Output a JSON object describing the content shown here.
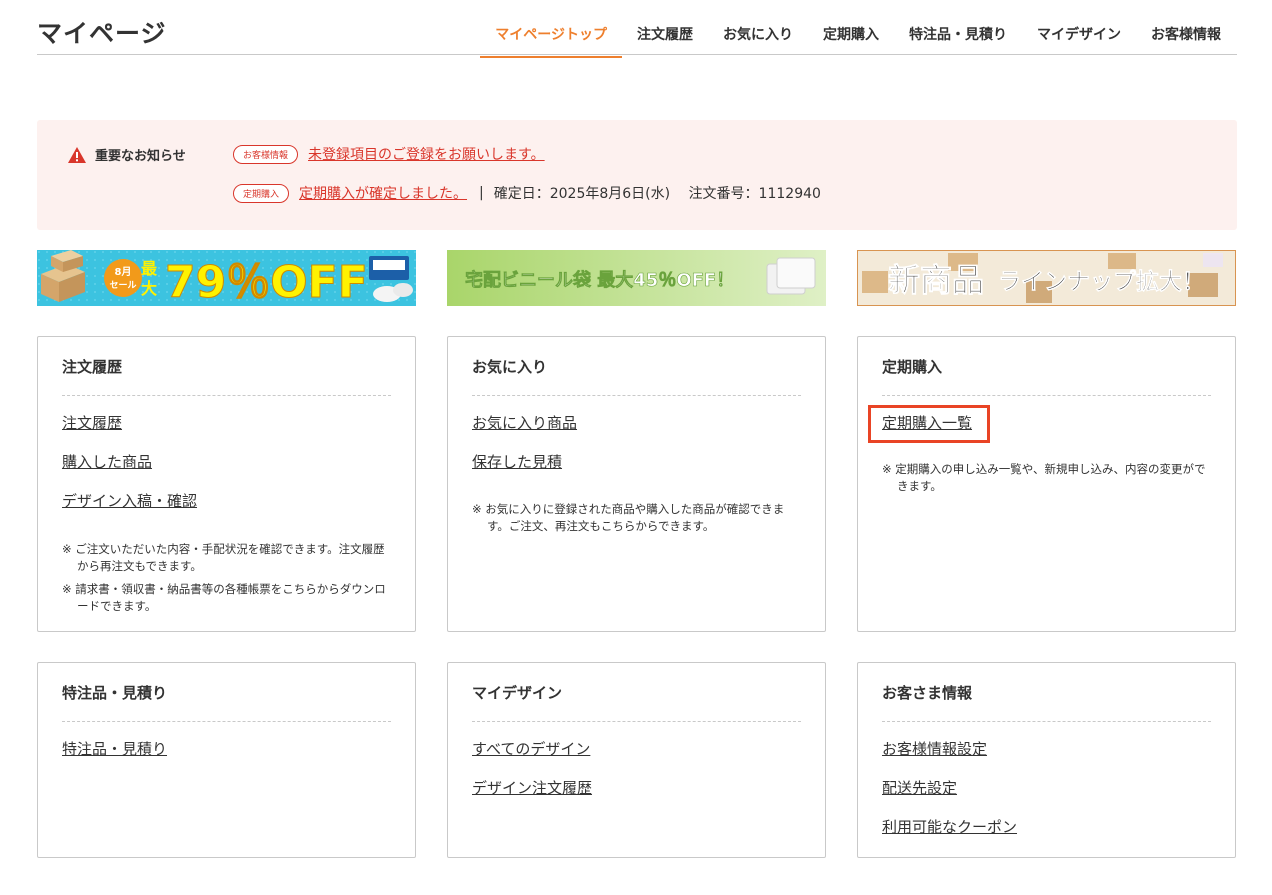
{
  "header": {
    "title": "マイページ",
    "nav": [
      {
        "label": "マイページトップ",
        "active": true
      },
      {
        "label": "注文履歴"
      },
      {
        "label": "お気に入り"
      },
      {
        "label": "定期購入"
      },
      {
        "label": "特注品・見積り"
      },
      {
        "label": "マイデザイン"
      },
      {
        "label": "お客様情報"
      }
    ]
  },
  "notice": {
    "heading": "重要なお知らせ",
    "items": [
      {
        "tag": "お客様情報",
        "link": "未登録項目のご登録をお願いします。"
      },
      {
        "tag": "定期購入",
        "link": "定期購入が確定しました。",
        "date": "確定日：2025年8月6日(水)",
        "order": "注文番号：1112940"
      }
    ]
  },
  "banners": {
    "b1": {
      "badge": "8月\nセール",
      "prefix": "最大",
      "main": "79％OFF"
    },
    "b2": {
      "text": "宅配ビニール袋 最大45％OFF！"
    },
    "b3": {
      "main": "新商品",
      "sub": "ラインナップ拡大！"
    }
  },
  "cards": {
    "orders": {
      "title": "注文履歴",
      "links": [
        "注文履歴",
        "購入した商品",
        "デザイン入稿・確認"
      ],
      "notes": [
        "※ ご注文いただいた内容・手配状況を確認できます。注文履歴から再注文もできます。",
        "※ 請求書・領収書・納品書等の各種帳票をこちらからダウンロードできます。"
      ]
    },
    "favorites": {
      "title": "お気に入り",
      "links": [
        "お気に入り商品",
        "保存した見積"
      ],
      "notes": [
        "※ お気に入りに登録された商品や購入した商品が確認できます。ご注文、再注文もこちらからできます。"
      ]
    },
    "subscription": {
      "title": "定期購入",
      "links": [
        "定期購入一覧"
      ],
      "notes": [
        "※ 定期購入の申し込み一覧や、新規申し込み、内容の変更ができます。"
      ]
    },
    "custom": {
      "title": "特注品・見積り",
      "links": [
        "特注品・見積り"
      ]
    },
    "mydesign": {
      "title": "マイデザイン",
      "links": [
        "すべてのデザイン",
        "デザイン注文履歴"
      ]
    },
    "customer": {
      "title": "お客さま情報",
      "links": [
        "お客様情報設定",
        "配送先設定",
        "利用可能なクーポン"
      ]
    }
  },
  "colors": {
    "accent": "#ee7f2d",
    "alert": "#d9362b",
    "notice_bg": "#fdf1ef",
    "highlight": "#e94425"
  }
}
